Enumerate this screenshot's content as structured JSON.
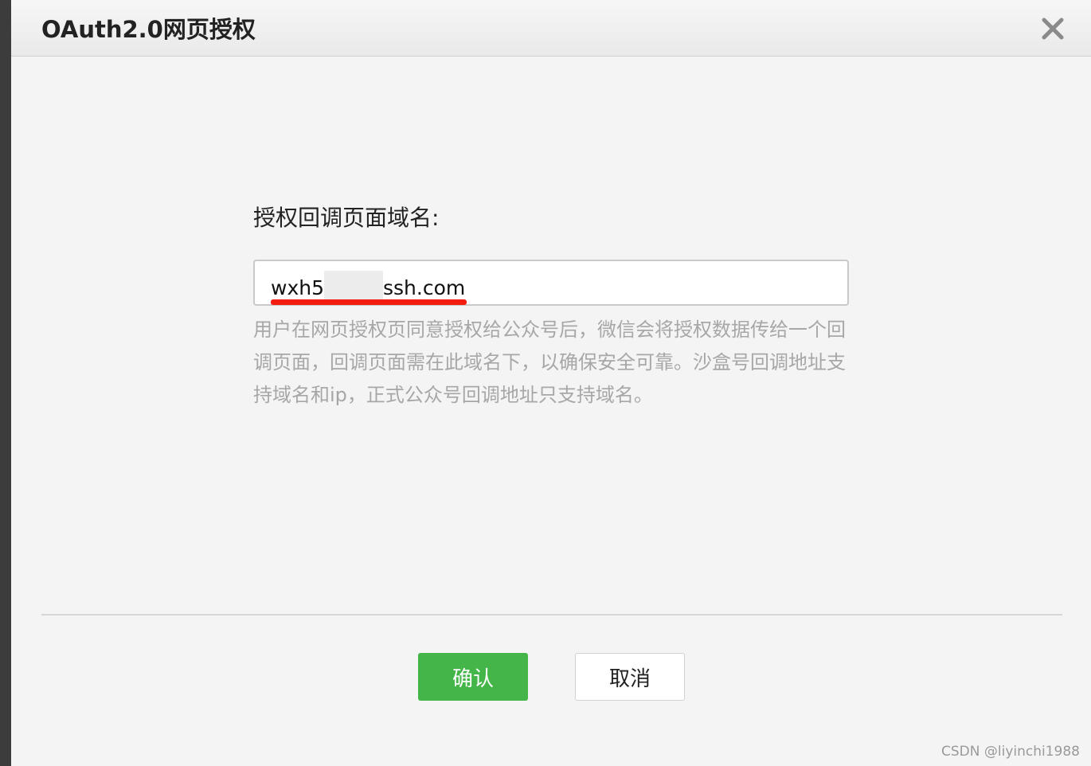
{
  "dialog": {
    "title": "OAuth2.0网页授权",
    "close_icon": "close-icon"
  },
  "form": {
    "label": "授权回调页面域名:",
    "input_prefix": "wxh5",
    "input_suffix": "ssh.com",
    "help_text": "用户在网页授权页同意授权给公众号后，微信会将授权数据传给一个回调页面，回调页面需在此域名下，以确保安全可靠。沙盒号回调地址支持域名和ip，正式公众号回调地址只支持域名。"
  },
  "buttons": {
    "confirm_label": "确认",
    "cancel_label": "取消"
  },
  "watermark": "CSDN @liyinchi1988",
  "colors": {
    "confirm_button": "#44b549",
    "underline_mark": "#f21d10",
    "help_text": "#a7a7a7"
  }
}
